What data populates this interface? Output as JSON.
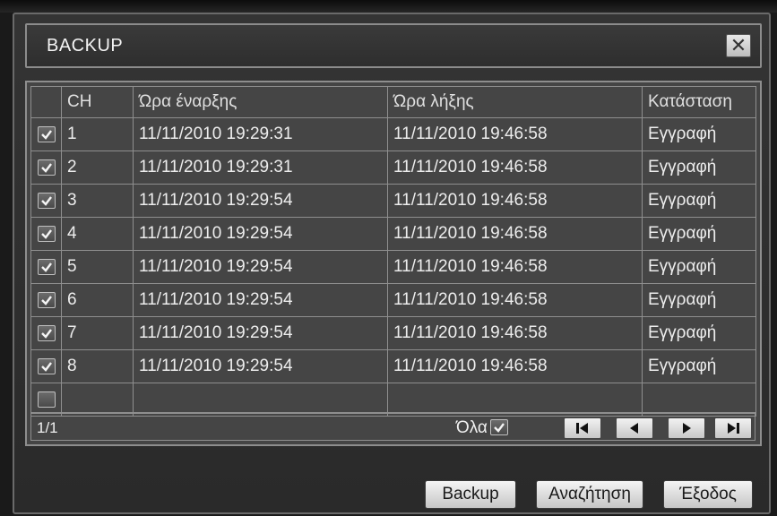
{
  "dialog": {
    "title": "BACKUP",
    "close_label": "✕"
  },
  "table": {
    "headers": [
      "CH",
      "Ώρα έναρξης",
      "Ώρα λήξης",
      "Κατάσταση"
    ],
    "rows": [
      {
        "checked": true,
        "ch": "1",
        "start": "11/11/2010 19:29:31",
        "end": "11/11/2010 19:46:58",
        "status": "Εγγραφή"
      },
      {
        "checked": true,
        "ch": "2",
        "start": "11/11/2010 19:29:31",
        "end": "11/11/2010 19:46:58",
        "status": "Εγγραφή"
      },
      {
        "checked": true,
        "ch": "3",
        "start": "11/11/2010 19:29:54",
        "end": "11/11/2010 19:46:58",
        "status": "Εγγραφή"
      },
      {
        "checked": true,
        "ch": "4",
        "start": "11/11/2010 19:29:54",
        "end": "11/11/2010 19:46:58",
        "status": "Εγγραφή"
      },
      {
        "checked": true,
        "ch": "5",
        "start": "11/11/2010 19:29:54",
        "end": "11/11/2010 19:46:58",
        "status": "Εγγραφή"
      },
      {
        "checked": true,
        "ch": "6",
        "start": "11/11/2010 19:29:54",
        "end": "11/11/2010 19:46:58",
        "status": "Εγγραφή"
      },
      {
        "checked": true,
        "ch": "7",
        "start": "11/11/2010 19:29:54",
        "end": "11/11/2010 19:46:58",
        "status": "Εγγραφή"
      },
      {
        "checked": true,
        "ch": "8",
        "start": "11/11/2010 19:29:54",
        "end": "11/11/2010 19:46:58",
        "status": "Εγγραφή"
      },
      {
        "checked": false,
        "ch": "",
        "start": "",
        "end": "",
        "status": ""
      }
    ]
  },
  "footer": {
    "page": "1/1",
    "select_all_label": "Όλα",
    "select_all_checked": true,
    "nav_icons": [
      "first-page-icon",
      "previous-page-icon",
      "next-page-icon",
      "last-page-icon"
    ]
  },
  "buttons": {
    "backup": "Backup",
    "search": "Αναζήτηση",
    "exit": "Έξοδος"
  }
}
